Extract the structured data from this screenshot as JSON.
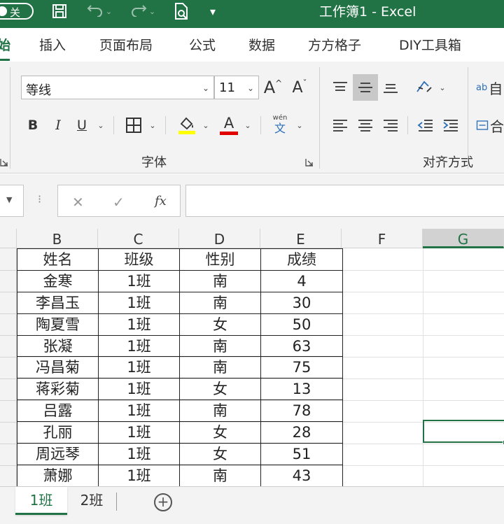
{
  "titlebar": {
    "autosave_state": "关",
    "doc_title": "工作簿1  -  Excel",
    "accent": "#217346"
  },
  "ribbon_tabs": [
    "始",
    "插入",
    "页面布局",
    "公式",
    "数据",
    "方方格子",
    "DIY工具箱"
  ],
  "font_group": {
    "font_name": "等线",
    "font_size": "11",
    "grow_label": "A",
    "shrink_label": "A",
    "bold_label": "B",
    "italic_label": "I",
    "underline_label": "U",
    "font_color_label": "A",
    "phonetic_top": "wén",
    "phonetic_bottom": "文",
    "group_label": "字体",
    "highlight_color": "#ffff00",
    "font_color": "#e00000"
  },
  "align_group": {
    "group_label": "对齐方式",
    "wrap_partial": "ab",
    "wrap_partial2": "自",
    "merge_partial": "合"
  },
  "formula_bar": {
    "cancel": "✕",
    "enter": "✓",
    "fx": "fx"
  },
  "columns": [
    "B",
    "C",
    "D",
    "E",
    "F",
    "G"
  ],
  "selected_column": "G",
  "table": {
    "headers": [
      "姓名",
      "班级",
      "性别",
      "成绩"
    ],
    "rows": [
      [
        "金寒",
        "1班",
        "南",
        "4"
      ],
      [
        "李昌玉",
        "1班",
        "南",
        "30"
      ],
      [
        "陶夏雪",
        "1班",
        "女",
        "50"
      ],
      [
        "张凝",
        "1班",
        "南",
        "63"
      ],
      [
        "冯昌菊",
        "1班",
        "南",
        "75"
      ],
      [
        "蒋彩菊",
        "1班",
        "女",
        "13"
      ],
      [
        "吕露",
        "1班",
        "南",
        "78"
      ],
      [
        "孔丽",
        "1班",
        "女",
        "28"
      ],
      [
        "周远琴",
        "1班",
        "女",
        "51"
      ],
      [
        "萧娜",
        "1班",
        "南",
        "43"
      ]
    ]
  },
  "sheet_tabs": [
    "1班",
    "2班"
  ],
  "active_sheet": "1班",
  "add_sheet": "+"
}
